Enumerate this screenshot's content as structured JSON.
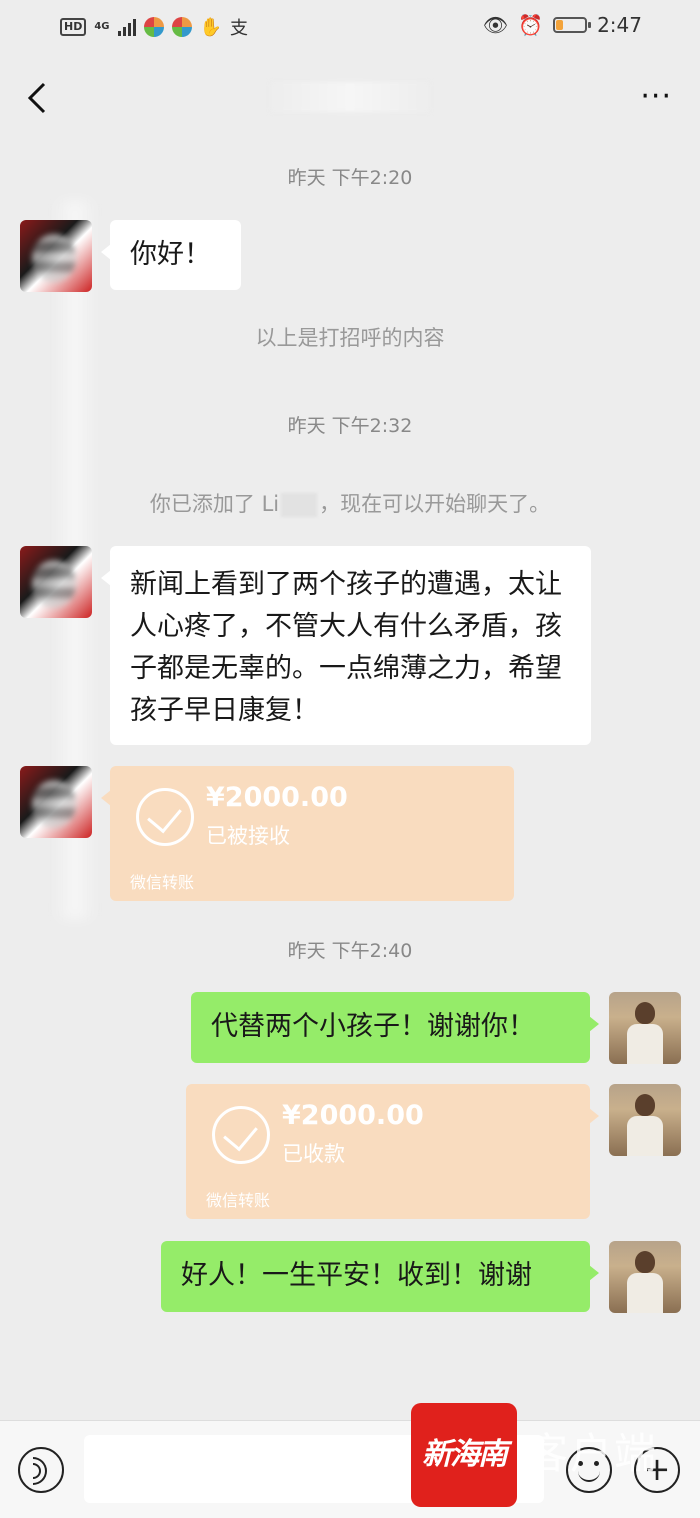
{
  "status_bar": {
    "hd": "HD",
    "network": "4G",
    "alipay": "支",
    "time": "2:47",
    "battery_level": 0.25,
    "accent_battery": "#f3a33a"
  },
  "nav": {
    "back_icon": "chevron-left-icon",
    "more_label": "···"
  },
  "messages": {
    "ts1": "昨天 下午2:20",
    "m1": "你好！",
    "sys_greeting": "以上是打招呼的内容",
    "ts2": "昨天 下午2:32",
    "sys_added_prefix": "你已添加了 Li",
    "sys_added_suffix": "，现在可以开始聊天了。",
    "m2": "新闻上看到了两个孩子的遭遇，太让人心疼了，不管大人有什么矛盾，孩子都是无辜的。一点绵薄之力，希望孩子早日康复！",
    "transfer1": {
      "amount": "¥2000.00",
      "status": "已被接收",
      "footer": "微信转账"
    },
    "ts3": "昨天 下午2:40",
    "m3": "代替两个小孩子！谢谢你！",
    "transfer2": {
      "amount": "¥2000.00",
      "status": "已收款",
      "footer": "微信转账"
    },
    "m4": "好人！一生平安！收到！谢谢"
  },
  "colors": {
    "bubble_self": "#95ec69",
    "bubble_other": "#ffffff",
    "transfer_card": "#f9dcbf",
    "background": "#ededed"
  },
  "input_bar": {
    "voice_icon": "voice-icon",
    "emoji_icon": "emoji-icon",
    "plus_icon": "plus-icon",
    "plus_label": "+"
  },
  "watermark": {
    "logo": "新海南",
    "text": "客户端"
  }
}
